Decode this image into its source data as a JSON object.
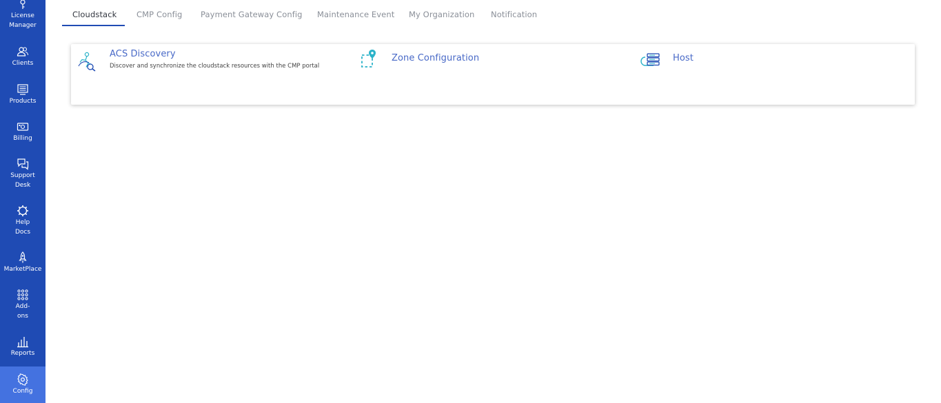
{
  "sidebar": {
    "items": [
      {
        "label": "License\nManager",
        "icon": "license-key-icon"
      },
      {
        "label": "Clients",
        "icon": "clients-icon"
      },
      {
        "label": "Products",
        "icon": "products-icon"
      },
      {
        "label": "Billing",
        "icon": "billing-icon"
      },
      {
        "label": "Support\nDesk",
        "icon": "support-chat-icon"
      },
      {
        "label": "Help\nDocs",
        "icon": "help-gear-icon"
      },
      {
        "label": "MarketPlace",
        "icon": "rocket-icon"
      },
      {
        "label": "Add-\nons",
        "icon": "grid-dots-icon"
      },
      {
        "label": "Reports",
        "icon": "bar-chart-icon"
      },
      {
        "label": "Config",
        "icon": "gear-icon"
      }
    ],
    "active": "Config"
  },
  "tabs": {
    "items": [
      "Cloudstack",
      "CMP Config",
      "Payment Gateway Config",
      "Maintenance Event",
      "My Organization",
      "Notification"
    ],
    "active": "Cloudstack"
  },
  "card": {
    "items": [
      {
        "title": "ACS Discovery",
        "description": "Discover and synchronize the cloudstack resources with the CMP portal",
        "icon": "discovery-icon"
      },
      {
        "title": "Zone Configuration",
        "description": "",
        "icon": "zone-pin-icon"
      },
      {
        "title": "Host",
        "description": "",
        "icon": "host-server-icon"
      }
    ]
  },
  "colors": {
    "sidebar_bg": "#1f4bb4",
    "sidebar_active": "#4472e0",
    "accent_title": "#4869c7",
    "icon_teal": "#2bb3c9"
  }
}
